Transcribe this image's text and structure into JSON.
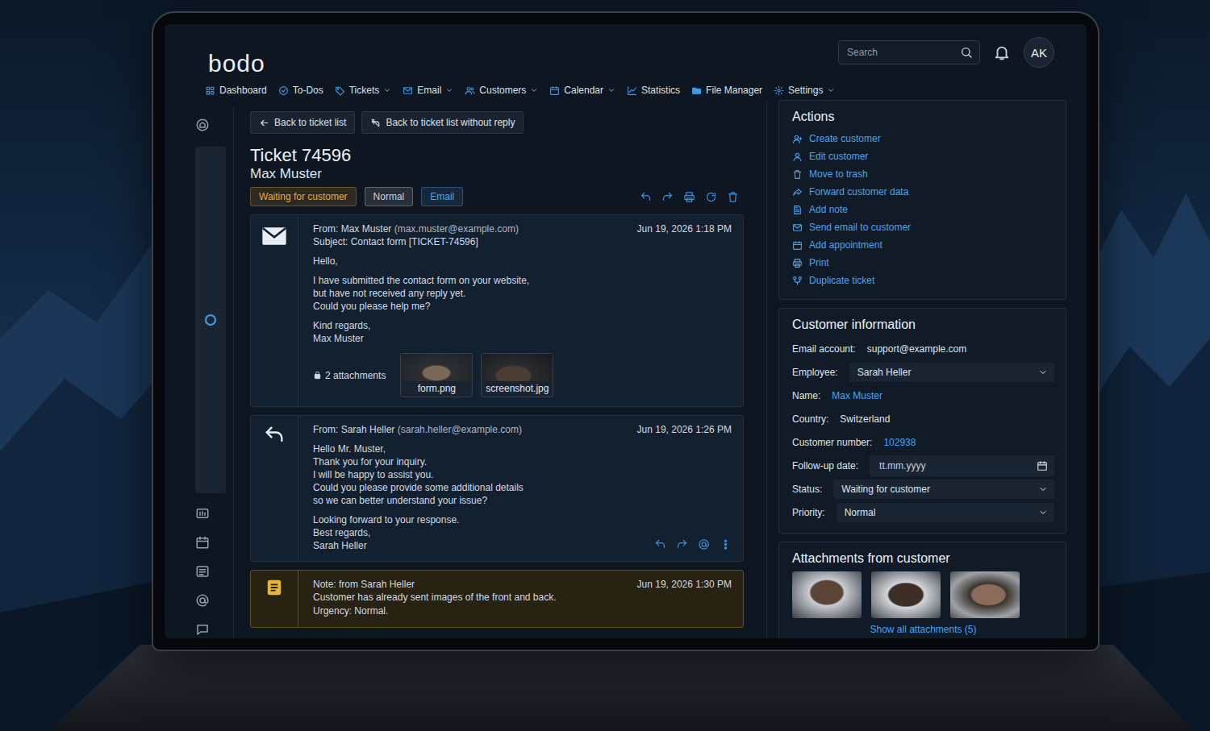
{
  "app": {
    "logo": "bodo"
  },
  "nav": [
    {
      "label": "Dashboard",
      "dropdown": false
    },
    {
      "label": "To-Dos",
      "dropdown": false
    },
    {
      "label": "Tickets",
      "dropdown": true
    },
    {
      "label": "Email",
      "dropdown": true
    },
    {
      "label": "Customers",
      "dropdown": true
    },
    {
      "label": "Calendar",
      "dropdown": true
    },
    {
      "label": "Statistics",
      "dropdown": false
    },
    {
      "label": "File Manager",
      "dropdown": false
    },
    {
      "label": "Settings",
      "dropdown": true
    }
  ],
  "search": {
    "placeholder": "Search"
  },
  "user": {
    "initials": "AK"
  },
  "sidebar": {
    "items": [
      {
        "selected": false
      },
      {
        "selected": true
      },
      {
        "selected": false
      },
      {
        "selected": false
      },
      {
        "selected": false
      },
      {
        "selected": false
      },
      {
        "selected": false
      }
    ]
  },
  "toolbar": {
    "buttons": [
      "Back to ticket list",
      "Back to ticket list without reply"
    ]
  },
  "ticket": {
    "title": "Ticket 74596",
    "customer": "Max Muster",
    "badges": [
      {
        "label": "Waiting for customer",
        "color": "#f0a830"
      },
      {
        "label": "Normal",
        "color": "#c9d1db"
      },
      {
        "label": "Email",
        "color": "#4aa3f0"
      }
    ]
  },
  "messages": [
    {
      "kind": "email",
      "from": "From: Max Muster",
      "address": "(max.muster@example.com)",
      "subject": "Subject: Contact form [TICKET-74596]",
      "date": "Jun 19, 2026 1:18 PM",
      "paragraphs": [
        [
          "Hello,"
        ],
        [
          "I have submitted the contact form on your website,",
          "but have not received any reply yet.",
          "Could you please help me?"
        ],
        [
          "Kind regards,",
          "Max Muster"
        ]
      ],
      "attachments_label": "2 attachments",
      "attachments": [
        "form.png",
        "screenshot.jpg"
      ]
    },
    {
      "kind": "reply",
      "from": "From: Sarah Heller",
      "address": "(sarah.heller@example.com)",
      "date": "Jun 19, 2026 1:26 PM",
      "paragraphs": [
        [
          "Hello Mr. Muster,",
          "Thank you for your inquiry.",
          "I will be happy to assist you.",
          "Could you please provide some additional details",
          "so we can better understand your issue?"
        ],
        [
          "Looking forward to your response.",
          "Best regards,",
          "Sarah Heller"
        ]
      ]
    },
    {
      "kind": "note",
      "title": "Note: from Sarah Heller",
      "date": "Jun 19, 2026 1:30 PM",
      "lines": [
        "Customer has already sent images of the front and back.",
        "Urgency: Normal."
      ]
    }
  ],
  "actions": {
    "title": "Actions",
    "items": [
      "Create customer",
      "Edit customer",
      "Move to trash",
      "Forward customer data",
      "Add note",
      "Send email to customer",
      "Add appointment",
      "Print",
      "Duplicate ticket"
    ]
  },
  "customer_info": {
    "title": "Customer information",
    "fields": [
      {
        "kind": "text",
        "label": "Email account:",
        "value": "support@example.com"
      },
      {
        "kind": "select",
        "label": "Employee:",
        "value": "Sarah Heller"
      },
      {
        "kind": "link",
        "label": "Name:",
        "value": "Max Muster"
      },
      {
        "kind": "text",
        "label": "Country:",
        "value": "Switzerland"
      },
      {
        "kind": "link",
        "label": "Customer number:",
        "value": "102938"
      },
      {
        "kind": "date",
        "label": "Follow-up date:",
        "placeholder": "tt.mm.yyyy"
      },
      {
        "kind": "select",
        "label": "Status:",
        "value": "Waiting for customer"
      },
      {
        "kind": "select",
        "label": "Priority:",
        "value": "Normal"
      }
    ]
  },
  "customer_attachments": {
    "title": "Attachments from customer",
    "link": "Show all attachments (5)"
  }
}
